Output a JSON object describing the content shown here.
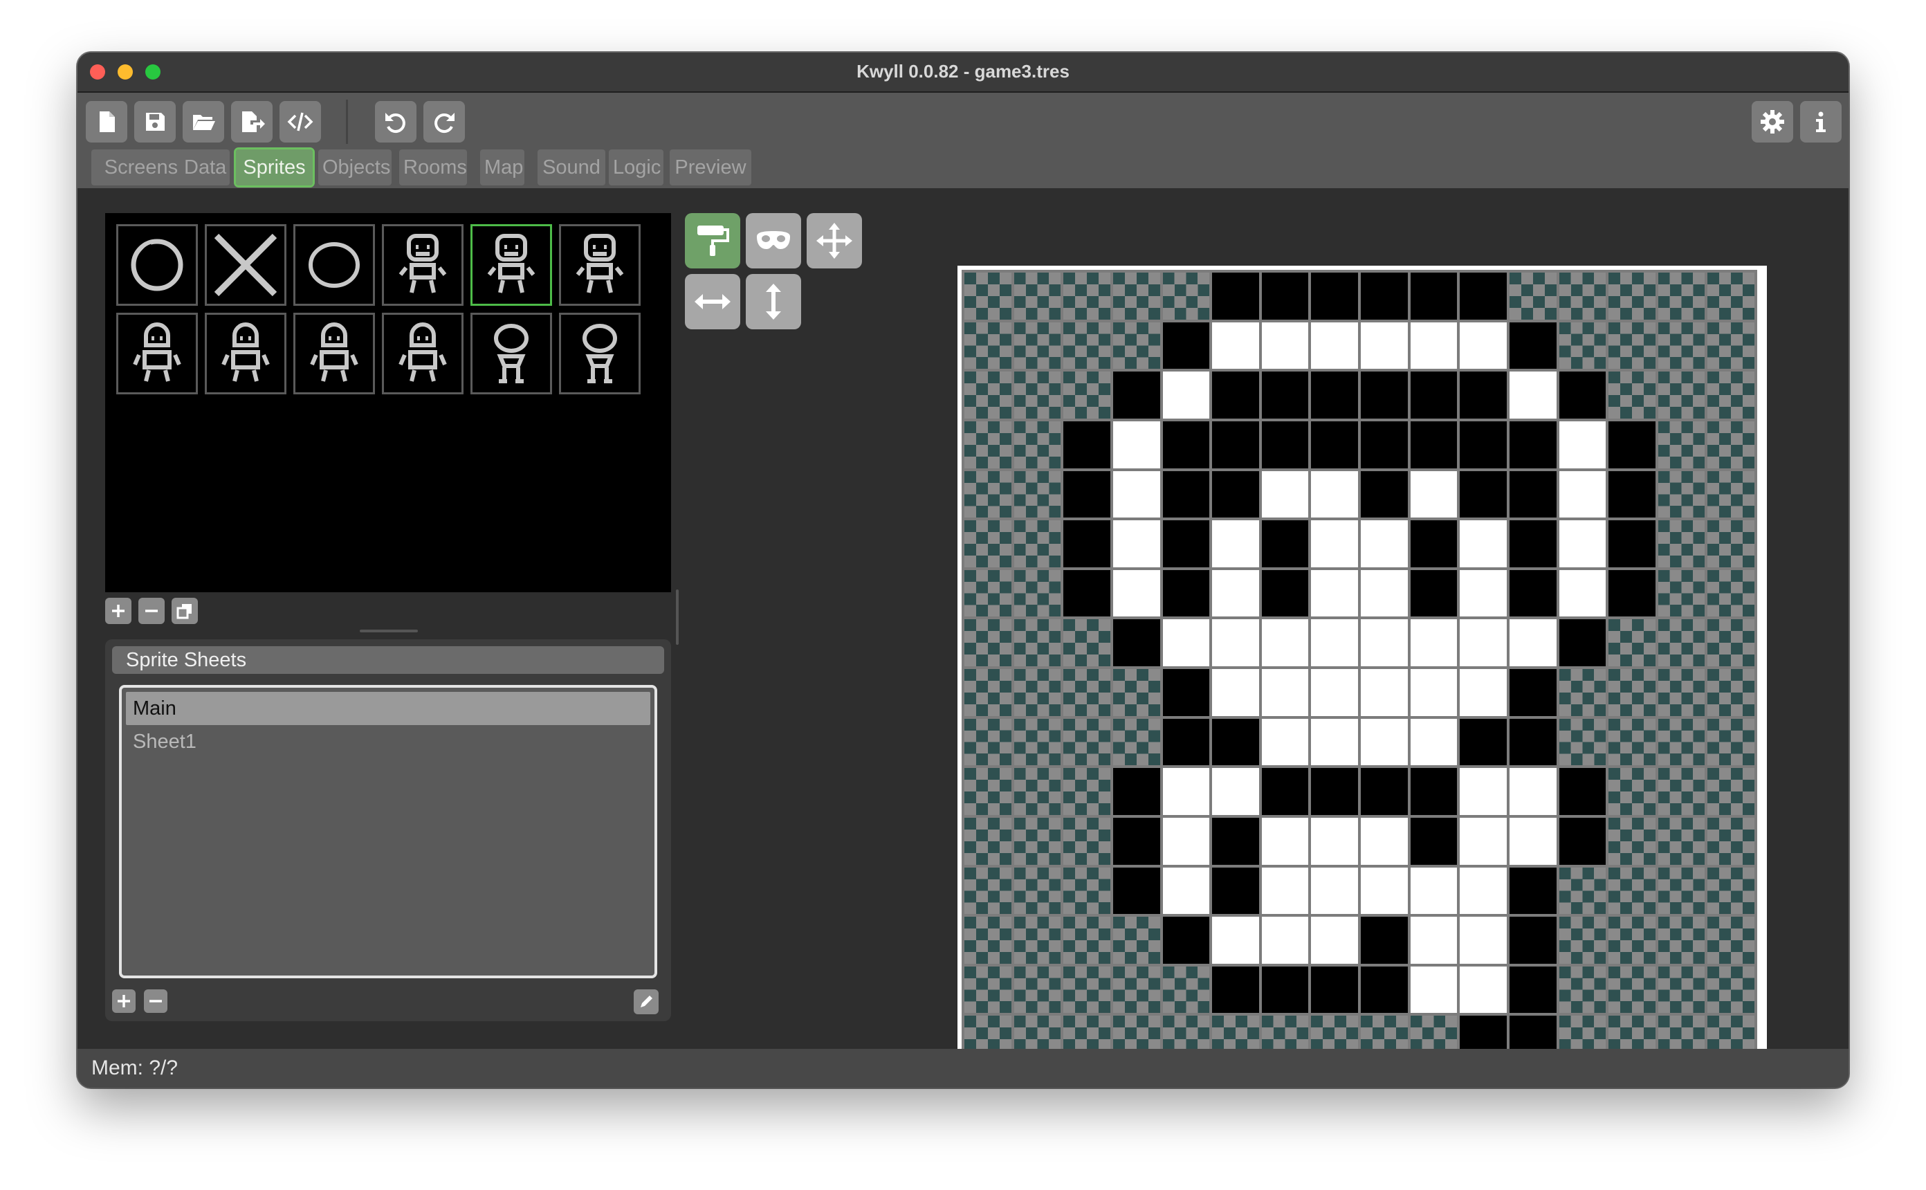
{
  "window": {
    "title": "Kwyll 0.0.82 - game3.tres"
  },
  "toolbar": {
    "buttons": [
      "new-file-icon",
      "save-icon",
      "open-folder-icon",
      "export-icon",
      "code-icon",
      "undo-icon",
      "redo-icon",
      "settings-icon",
      "info-icon"
    ]
  },
  "tabs": [
    {
      "label": "Screens"
    },
    {
      "label": "Data"
    },
    {
      "label": "Sprites"
    },
    {
      "label": "Objects"
    },
    {
      "label": "Rooms"
    },
    {
      "label": "Map"
    },
    {
      "label": "Sound"
    },
    {
      "label": "Logic"
    },
    {
      "label": "Preview"
    }
  ],
  "active_tab": "Sprites",
  "sprites": {
    "count": 12,
    "selected_index": 4,
    "thumbnails": [
      "ring",
      "cross",
      "ring-small",
      "figure-a",
      "figure-a",
      "figure-a",
      "figure-b",
      "figure-b",
      "figure-b",
      "figure-b",
      "figure-c",
      "figure-c"
    ]
  },
  "sprite_sheets": {
    "header": "Sprite Sheets",
    "items": [
      "Main",
      "Sheet1"
    ],
    "selected": "Main"
  },
  "tools": [
    "paint-roller-icon",
    "mask-icon",
    "move-icon",
    "flip-horizontal-icon",
    "flip-vertical-icon"
  ],
  "active_tool": "paint-roller-icon",
  "editor": {
    "size": 16,
    "legend": {
      "t": "transparent",
      "b": "black",
      "w": "white"
    },
    "rows": [
      "tttttbbbbbbttttt",
      "ttttbwwwwwwbtttt",
      "tttbwbbbbbbwbttt",
      "ttbwbbbbbbbbwbtt",
      "ttbwbbwwbwbbwbtt",
      "ttbwbwbwwbwbwbtt",
      "ttbwbwbwwbwbwbtt",
      "tttbwwwwwwwwbttt",
      "ttttbwwwwwwbtttt",
      "ttttbbwwwwbbtttt",
      "tttbwwbbbbwwbttt",
      "tttbwbwwwbwwbttt",
      "tttbwbwwwwwbtttt",
      "ttttbwwwbwwbtttt",
      "tttttbbbbwwbtttt",
      "ttttttttttbbtttt"
    ]
  },
  "colors": {
    "accent": "#6cbf60",
    "transparent_a": "#8a8a8a",
    "transparent_b": "#2f5050"
  },
  "status": {
    "text": "Mem: ?/?"
  }
}
